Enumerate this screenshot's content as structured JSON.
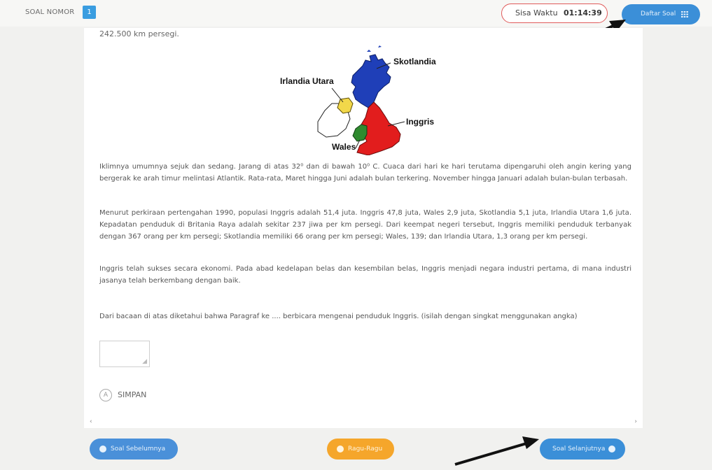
{
  "topbar": {
    "soal_label": "SOAL NOMOR",
    "soal_number": "1",
    "timer_label": "Sisa Waktu",
    "timer_value": "01:14:39",
    "daftar_label": "Daftar Soal"
  },
  "content": {
    "cut_text": "242.500 km persegi.",
    "map_labels": {
      "skotlandia": "Skotlandia",
      "irlandia_utara": "Irlandia Utara",
      "inggris": "Inggris",
      "wales": "Wales"
    },
    "paragraphs": [
      "Iklimnya umumnya sejuk dan sedang. Jarang di atas 32⁰ dan di bawah 10⁰ C. Cuaca dari hari ke hari terutama dipengaruhi oleh angin kering yang bergerak ke arah timur melintasi Atlantik. Rata-rata, Maret hingga Juni adalah bulan terkering. November hingga Januari adalah bulan-bulan terbasah.",
      "Menurut perkiraan pertengahan 1990, populasi Inggris adalah 51,4 juta. Inggris 47,8 juta, Wales 2,9 juta, Skotlandia 5,1 juta, Irlandia Utara 1,6 juta. Kepadatan penduduk di Britania Raya adalah sekitar 237 jiwa per km persegi. Dari keempat negeri tersebut, Inggris memiliki penduduk terbanyak dengan 367 orang per km persegi; Skotlandia memiliki 66 orang per km persegi; Wales, 139; dan Irlandia Utara, 1,3 orang per km persegi.",
      "Inggris telah sukses secara ekonomi. Pada abad kedelapan belas dan kesembilan belas, Inggris menjadi negara industri pertama, di mana industri jasanya telah berkembang dengan baik."
    ],
    "question": "Dari bacaan di atas diketahui bahwa Paragraf ke .... berbicara mengenai penduduk Inggris. (isilah dengan singkat menggunakan angka)",
    "answer_value": "",
    "simpan_option": "A",
    "simpan_label": "SIMPAN"
  },
  "bottom": {
    "prev_label": "Soal Sebelumnya",
    "ragu_label": "Ragu-Ragu",
    "next_label": "Soal Selanjutnya"
  },
  "colors": {
    "primary_blue": "#3b8fd8",
    "ragu_orange": "#f5a62b",
    "timer_border": "#e05a5a",
    "map_scotland": "#1f3fb8",
    "map_england": "#e21d1d",
    "map_wales": "#2f8a2f",
    "map_northern_ireland": "#f2d84a"
  }
}
